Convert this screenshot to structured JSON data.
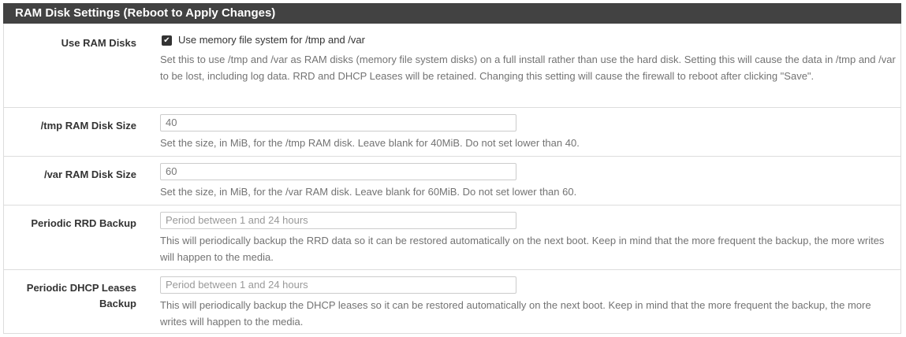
{
  "panel": {
    "title": "RAM Disk Settings (Reboot to Apply Changes)"
  },
  "fields": [
    {
      "label": "Use RAM Disks",
      "checkbox_label": "Use memory file system for /tmp and /var",
      "checked": true,
      "help": "Set this to use /tmp and /var as RAM disks (memory file system disks) on a full install rather than use the hard disk. Setting this will cause the data in /tmp and /var to be lost, including log data. RRD and DHCP Leases will be retained. Changing this setting will cause the firewall to reboot after clicking \"Save\"."
    },
    {
      "label": "/tmp RAM Disk Size",
      "value": "40",
      "placeholder": "",
      "help": "Set the size, in MiB, for the /tmp RAM disk. Leave blank for 40MiB. Do not set lower than 40."
    },
    {
      "label": "/var RAM Disk Size",
      "value": "60",
      "placeholder": "",
      "help": "Set the size, in MiB, for the /var RAM disk. Leave blank for 60MiB. Do not set lower than 60."
    },
    {
      "label": "Periodic RRD Backup",
      "value": "",
      "placeholder": "Period between 1 and 24 hours",
      "help": "This will periodically backup the RRD data so it can be restored automatically on the next boot. Keep in mind that the more frequent the backup, the more writes will happen to the media."
    },
    {
      "label_line1": "Periodic DHCP Leases",
      "label_line2": "Backup",
      "value": "",
      "placeholder": "Period between 1 and 24 hours",
      "help": "This will periodically backup the DHCP leases so it can be restored automatically on the next boot. Keep in mind that the more frequent the backup, the more writes will happen to the media."
    }
  ],
  "colors": {
    "heading_bg": "#424242",
    "heading_text": "#ffffff",
    "help_text": "#737373",
    "border": "#dddddd"
  }
}
